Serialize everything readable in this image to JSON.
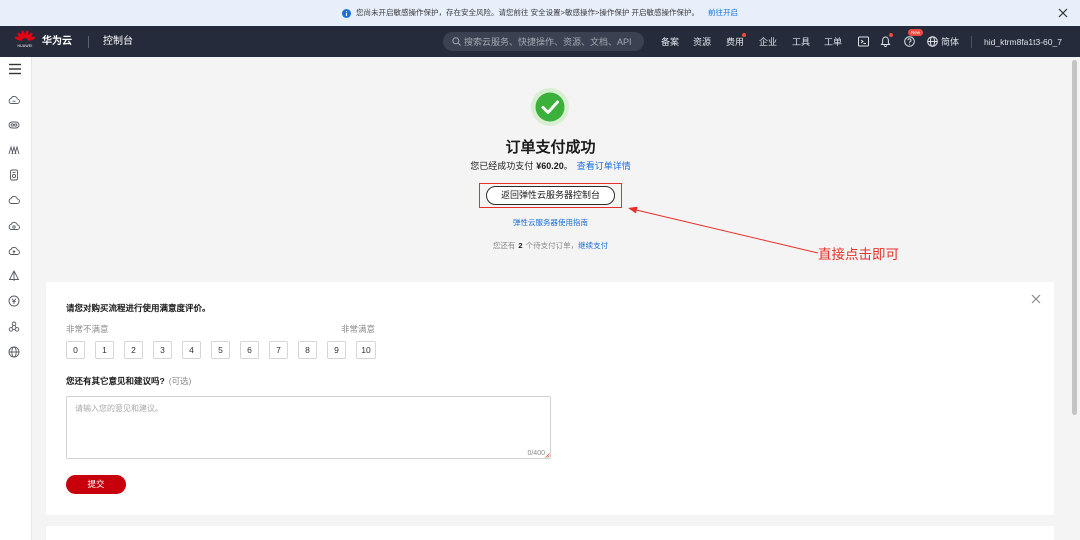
{
  "notice": {
    "icon": "info-icon",
    "text": "您尚未开启敏感操作保护，存在安全风险。请您前往 安全设置>敏感操作>操作保护 开启敏感操作保护。",
    "link": "前往开启"
  },
  "header": {
    "logo_text": "HUAWEI",
    "brand": "华为云",
    "console": "控制台",
    "search_placeholder": "搜索云服务、快捷操作、资源、文档、API",
    "nav": [
      "备案",
      "资源",
      "费用",
      "企业",
      "工具",
      "工单"
    ],
    "help_badge": "New",
    "language": "简体",
    "username": "hid_ktrm8fa1t3-60_7"
  },
  "sidebar": {
    "icons": [
      "menu-icon",
      "cloud-server-icon",
      "cloud-database-icon",
      "cluster-icon",
      "storage-icon",
      "cloud-icon",
      "cloud-settings-icon",
      "cloud-upload-icon",
      "deploy-icon",
      "billing-icon",
      "network-nodes-icon",
      "globe-icon"
    ]
  },
  "success": {
    "title": "订单支付成功",
    "paid_prefix": "您已经成功支付",
    "amount": "¥60.20",
    "paid_suffix": "。",
    "order_link": "查看订单详情",
    "back_button": "返回弹性云服务器控制台",
    "guide_link": "弹性云服务器使用指南",
    "pending_prefix": "您还有",
    "pending_count": "2",
    "pending_suffix": "个待支付订单，",
    "continue_link": "继续支付"
  },
  "annotation": {
    "text": "直接点击即可"
  },
  "survey": {
    "question": "请您对购买流程进行使用满意度评价。",
    "low_label": "非常不满意",
    "high_label": "非常满意",
    "scores": [
      "0",
      "1",
      "2",
      "3",
      "4",
      "5",
      "6",
      "7",
      "8",
      "9",
      "10"
    ],
    "comment_label": "您还有其它意见和建议吗?",
    "optional_label": "(可选)",
    "comment_placeholder": "请输入您的意见和建议。",
    "counter": "0/400",
    "submit": "提交"
  },
  "colors": {
    "brand_red": "#c7000b",
    "link_blue": "#1a6fe0",
    "success_green": "#3bb03a",
    "annotation_red": "#e8302a",
    "header_bg": "#252b3a",
    "notice_bg": "#e6effa"
  }
}
